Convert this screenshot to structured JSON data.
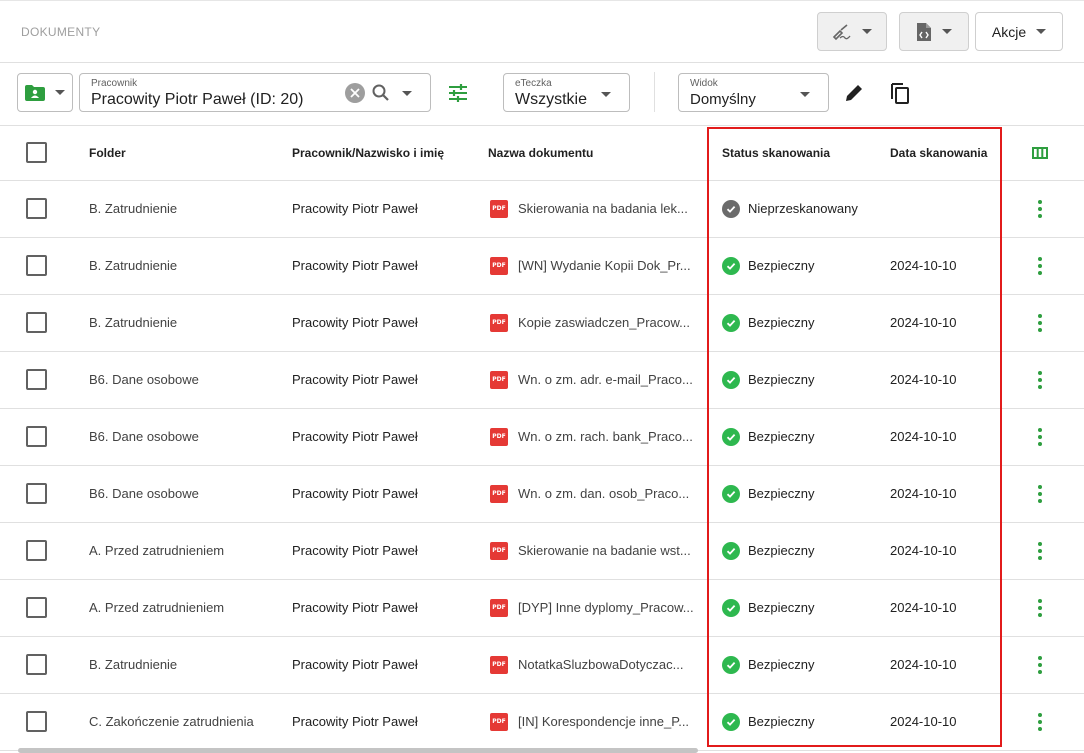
{
  "header": {
    "title": "DOKUMENTY",
    "akcje_label": "Akcje"
  },
  "filters": {
    "pracownik": {
      "label": "Pracownik",
      "value": "Pracowity Piotr Paweł (ID: 20)"
    },
    "eteczka": {
      "label": "eTeczka",
      "value": "Wszystkie"
    },
    "widok": {
      "label": "Widok",
      "value": "Domyślny"
    }
  },
  "table": {
    "columns": [
      "Folder",
      "Pracownik/Nazwisko i imię",
      "Nazwa dokumentu",
      "Status skanowania",
      "Data skanowania"
    ],
    "rows": [
      {
        "folder": "B. Zatrudnienie",
        "employee": "Pracowity Piotr Paweł",
        "doc": "Skierowania na badania lek...",
        "status": "Nieprzeskanowany",
        "status_type": "neutral",
        "date": ""
      },
      {
        "folder": "B. Zatrudnienie",
        "employee": "Pracowity Piotr Paweł",
        "doc": "[WN] Wydanie Kopii Dok_Pr...",
        "status": "Bezpieczny",
        "status_type": "ok",
        "date": "2024-10-10"
      },
      {
        "folder": "B. Zatrudnienie",
        "employee": "Pracowity Piotr Paweł",
        "doc": "Kopie zaswiadczen_Pracow...",
        "status": "Bezpieczny",
        "status_type": "ok",
        "date": "2024-10-10"
      },
      {
        "folder": "B6. Dane osobowe",
        "employee": "Pracowity Piotr Paweł",
        "doc": "Wn. o zm. adr. e-mail_Praco...",
        "status": "Bezpieczny",
        "status_type": "ok",
        "date": "2024-10-10"
      },
      {
        "folder": "B6. Dane osobowe",
        "employee": "Pracowity Piotr Paweł",
        "doc": "Wn. o zm. rach. bank_Praco...",
        "status": "Bezpieczny",
        "status_type": "ok",
        "date": "2024-10-10"
      },
      {
        "folder": "B6. Dane osobowe",
        "employee": "Pracowity Piotr Paweł",
        "doc": "Wn. o zm. dan. osob_Praco...",
        "status": "Bezpieczny",
        "status_type": "ok",
        "date": "2024-10-10"
      },
      {
        "folder": "A. Przed zatrudnieniem",
        "employee": "Pracowity Piotr Paweł",
        "doc": "Skierowanie na badanie wst...",
        "status": "Bezpieczny",
        "status_type": "ok",
        "date": "2024-10-10"
      },
      {
        "folder": "A. Przed zatrudnieniem",
        "employee": "Pracowity Piotr Paweł",
        "doc": "[DYP] Inne dyplomy_Pracow...",
        "status": "Bezpieczny",
        "status_type": "ok",
        "date": "2024-10-10"
      },
      {
        "folder": "B. Zatrudnienie",
        "employee": "Pracowity Piotr Paweł",
        "doc": "NotatkaSluzbowaDotyczac...",
        "status": "Bezpieczny",
        "status_type": "ok",
        "date": "2024-10-10"
      },
      {
        "folder": "C. Zakończenie zatrudnienia",
        "employee": "Pracowity Piotr Paweł",
        "doc": "[IN] Korespondencje inne_P...",
        "status": "Bezpieczny",
        "status_type": "ok",
        "date": "2024-10-10"
      }
    ]
  },
  "icons": {
    "pdf_badge": "PDF",
    "ok_color": "#2eb84f",
    "neutral_color": "#6b6b6b",
    "accent_color": "#2e9e3f",
    "highlight_color": "#e21b1b"
  }
}
